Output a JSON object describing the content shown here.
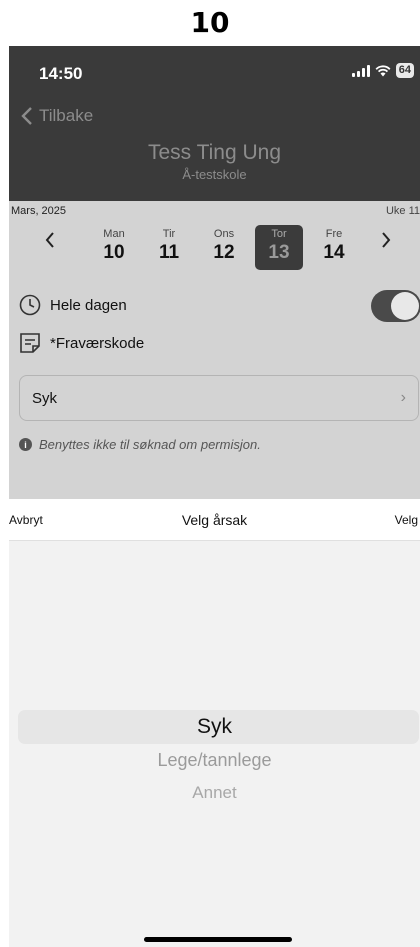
{
  "frame_label": "10",
  "status": {
    "time": "14:50",
    "battery": "64"
  },
  "header": {
    "back_label": "Tilbake",
    "student_name": "Tess Ting Ung",
    "school_name": "Å-testskole"
  },
  "calendar": {
    "month": "Mars, 2025",
    "week": "Uke 11",
    "days": [
      {
        "name": "Man",
        "num": "10"
      },
      {
        "name": "Tir",
        "num": "11"
      },
      {
        "name": "Ons",
        "num": "12"
      },
      {
        "name": "Tor",
        "num": "13",
        "selected": true
      },
      {
        "name": "Fre",
        "num": "14"
      }
    ]
  },
  "form": {
    "all_day_label": "Hele dagen",
    "all_day_on": true,
    "absence_code_label": "*Fraværskode",
    "selected_reason": "Syk",
    "info_text": "Benyttes ikke til søknad om permisjon."
  },
  "picker": {
    "cancel_label": "Avbryt",
    "title": "Velg årsak",
    "done_label": "Velg",
    "options": [
      "Syk",
      "Lege/tannlege",
      "Annet"
    ],
    "selected_index": 0
  },
  "colors": {
    "header_bg": "#3a3a3a",
    "dim_bg": "#d3d3d3",
    "sheet_bg": "#f2f2f2"
  }
}
